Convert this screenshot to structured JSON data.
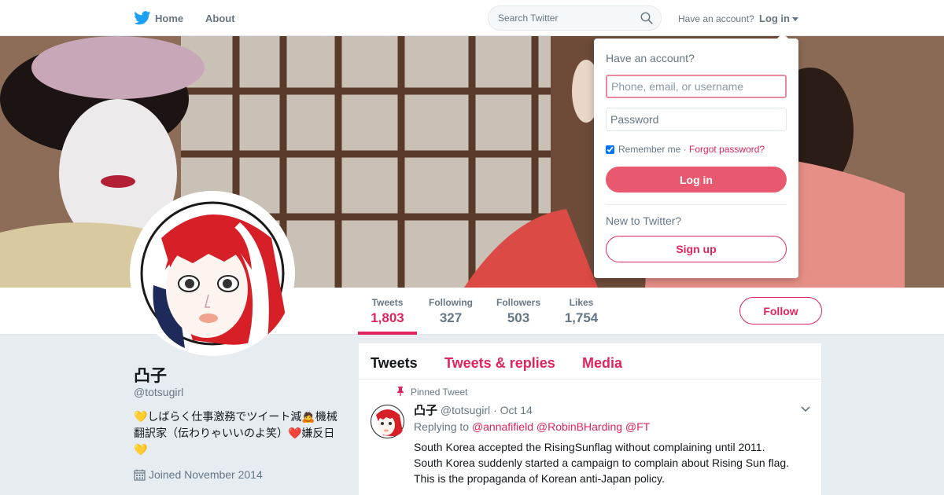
{
  "nav": {
    "home_label": "Home",
    "about_label": "About",
    "search_placeholder": "Search Twitter",
    "have_account": "Have an account?",
    "login_label": "Log in",
    "brand_color": "#1da1f2"
  },
  "login_dropdown": {
    "title": "Have an account?",
    "username_placeholder": "Phone, email, or username",
    "password_placeholder": "Password",
    "remember_label": "Remember me",
    "separator": "·",
    "forgot_label": "Forgot password?",
    "login_button": "Log in",
    "new_label": "New to Twitter?",
    "signup_button": "Sign up",
    "remember_checked": true
  },
  "profile": {
    "name": "凸子",
    "handle": "@totsugirl",
    "bio": "💛しばらく仕事激務でツイート減🙇機械翻訳家（伝わりゃいいのよ笑）❤️嫌反日💛",
    "joined": "Joined November 2014",
    "accent_color": "#e0245e"
  },
  "stats": [
    {
      "label": "Tweets",
      "value": "1,803"
    },
    {
      "label": "Following",
      "value": "327"
    },
    {
      "label": "Followers",
      "value": "503"
    },
    {
      "label": "Likes",
      "value": "1,754"
    }
  ],
  "follow_button": "Follow",
  "timeline": {
    "tabs": [
      {
        "label": "Tweets"
      },
      {
        "label": "Tweets & replies"
      },
      {
        "label": "Media"
      }
    ],
    "pinned_label": "Pinned Tweet",
    "tweet": {
      "name": "凸子",
      "handle": "@totsugirl",
      "separator": "·",
      "date": "Oct 14",
      "replying_label": "Replying to",
      "mentions": [
        "@annafifield",
        "@RobinBHarding",
        "@FT"
      ],
      "lines": [
        "South Korea accepted the RisingSunflag without complaining until 2011.",
        "South Korea suddenly started a campaign to complain about Rising Sun flag.",
        "This is the propaganda of Korean anti-Japan policy."
      ]
    }
  }
}
